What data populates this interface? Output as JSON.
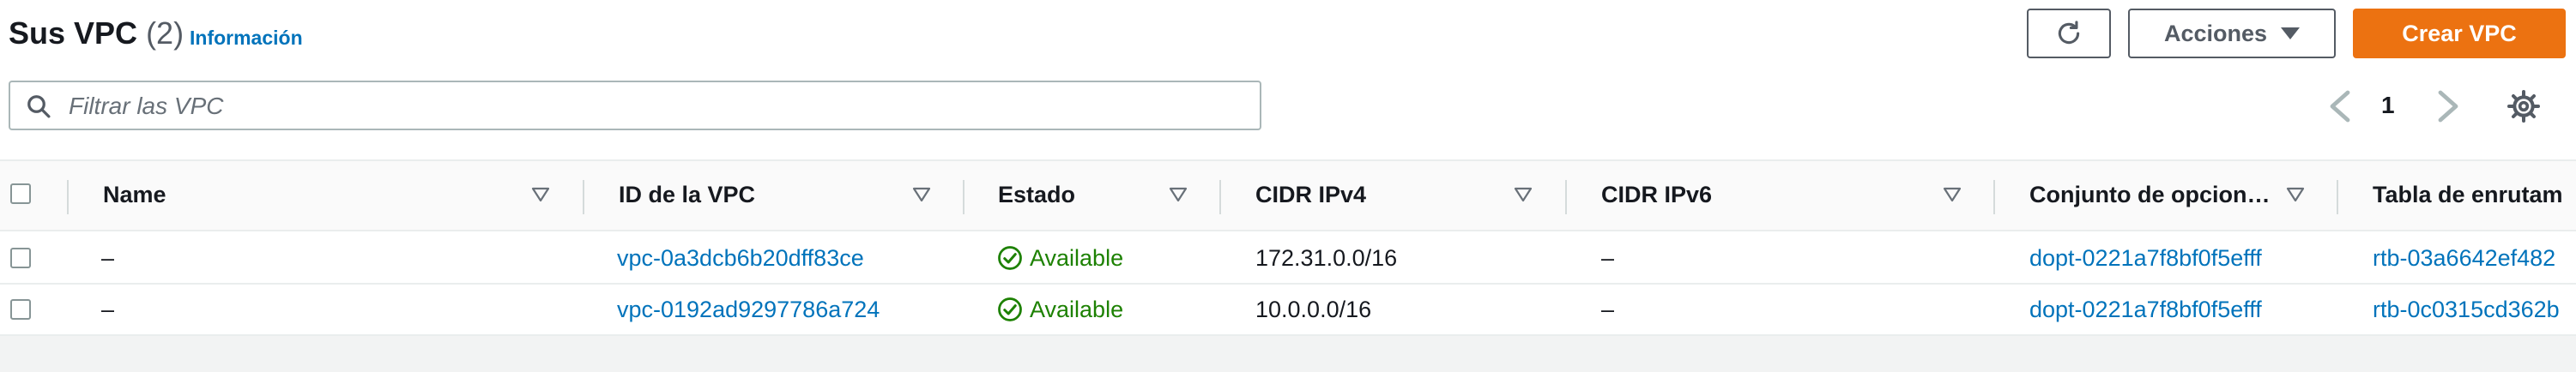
{
  "header": {
    "title": "Sus VPC",
    "count": "(2)",
    "info_link": "Información",
    "acciones_label": "Acciones",
    "create_label": "Crear VPC"
  },
  "search": {
    "placeholder": "Filtrar las VPC",
    "value": ""
  },
  "pagination": {
    "current_page": "1"
  },
  "table": {
    "columns": [
      "Name",
      "ID de la VPC",
      "Estado",
      "CIDR IPv4",
      "CIDR IPv6",
      "Conjunto de opcion…",
      "Tabla de enrutam"
    ],
    "rows": [
      {
        "name": "–",
        "vpc_id": "vpc-0a3dcb6b20dff83ce",
        "status": "Available",
        "cidr_ipv4": "172.31.0.0/16",
        "cidr_ipv6": "–",
        "dhcp_options": "dopt-0221a7f8bf0f5efff",
        "route_table": "rtb-03a6642ef482"
      },
      {
        "name": "–",
        "vpc_id": "vpc-0192ad9297786a724",
        "status": "Available",
        "cidr_ipv4": "10.0.0.0/16",
        "cidr_ipv6": "–",
        "dhcp_options": "dopt-0221a7f8bf0f5efff",
        "route_table": "rtb-0c0315cd362b"
      }
    ]
  },
  "colors": {
    "primary": "#ec7211",
    "link": "#0073bb",
    "success": "#1d8102",
    "text": "#16191f"
  },
  "icons": [
    "search-icon",
    "refresh-icon",
    "caret-down-icon",
    "chevron-left-icon",
    "chevron-right-icon",
    "gear-icon",
    "sort-icon",
    "status-ok-icon"
  ]
}
